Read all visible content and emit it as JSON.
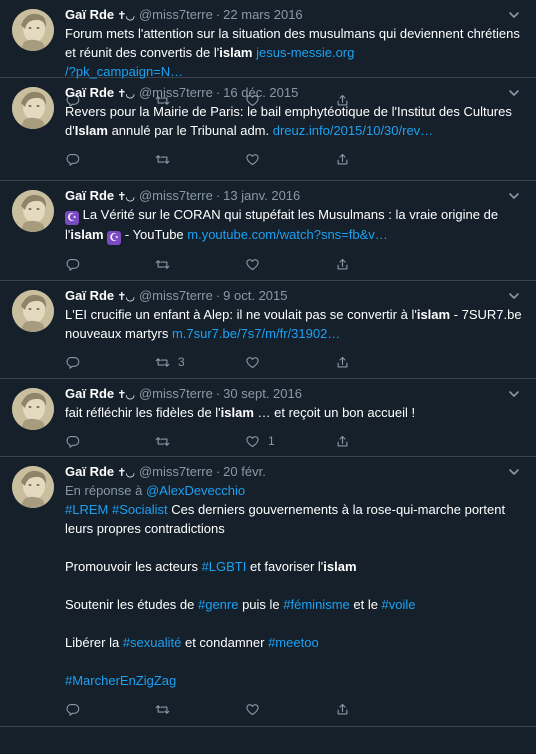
{
  "tweets": [
    {
      "name": "Gaï Rde",
      "badge": "✝◡",
      "handle": "@miss7terre",
      "sep": "·",
      "date": "22 mars 2016",
      "segments": [
        {
          "t": "Forum mets l'attention sur la situation des musulmans qui deviennent chrétiens et réunit des convertis de l'"
        },
        {
          "t": "islam",
          "b": true
        },
        {
          "t": " "
        },
        {
          "t": "jesus-messie.org\n/?pk_campaign=N…",
          "l": true
        }
      ],
      "counts": {
        "reply": "",
        "retweet": "",
        "like": ""
      }
    },
    {
      "name": "Gaï Rde",
      "badge": "✝◡",
      "handle": "@miss7terre",
      "sep": "·",
      "date": "16 déc. 2015",
      "segments": [
        {
          "t": "Revers pour la Mairie de Paris: le bail emphytéotique de l'Institut des Cultures d'"
        },
        {
          "t": "Islam",
          "b": true
        },
        {
          "t": " annulé par le Tribunal adm. "
        },
        {
          "t": "dreuz.info/2015/10/30/rev…",
          "l": true
        }
      ],
      "counts": {
        "reply": "",
        "retweet": "",
        "like": ""
      }
    },
    {
      "name": "Gaï Rde",
      "badge": "✝◡",
      "handle": "@miss7terre",
      "sep": "·",
      "date": "13 janv. 2016",
      "segments": [
        {
          "e": "☪"
        },
        {
          "t": " La Vérité sur le CORAN qui stupéfait les Musulmans : la vraie origine de l'"
        },
        {
          "t": "islam",
          "b": true
        },
        {
          "t": " "
        },
        {
          "e": "☪"
        },
        {
          "t": " - YouTube "
        },
        {
          "t": "m.youtube.com/watch?sns=fb&v…",
          "l": true
        }
      ],
      "counts": {
        "reply": "",
        "retweet": "",
        "like": ""
      }
    },
    {
      "name": "Gaï Rde",
      "badge": "✝◡",
      "handle": "@miss7terre",
      "sep": "·",
      "date": "9 oct. 2015",
      "segments": [
        {
          "t": "L'EI crucifie un enfant à Alep: il ne voulait pas se convertir à l'"
        },
        {
          "t": "islam",
          "b": true
        },
        {
          "t": " - 7SUR7.be nouveaux martyrs "
        },
        {
          "t": "m.7sur7.be/7s7/m/fr/31902…",
          "l": true
        }
      ],
      "counts": {
        "reply": "",
        "retweet": "3",
        "like": ""
      }
    },
    {
      "name": "Gaï Rde",
      "badge": "✝◡",
      "handle": "@miss7terre",
      "sep": "·",
      "date": "30 sept. 2016",
      "segments": [
        {
          "t": "fait réfléchir les fidèles de l'"
        },
        {
          "t": "islam",
          "b": true
        },
        {
          "t": " … et reçoit un bon accueil !"
        }
      ],
      "counts": {
        "reply": "",
        "retweet": "",
        "like": "1"
      }
    },
    {
      "name": "Gaï Rde",
      "badge": "✝◡",
      "handle": "@miss7terre",
      "sep": "·",
      "date": "20 févr.",
      "reply_prefix": "En réponse à ",
      "reply_to": "@AlexDevecchio",
      "segments": [
        {
          "t": "#LREM",
          "l": true
        },
        {
          "t": " "
        },
        {
          "t": "#Socialist",
          "l": true
        },
        {
          "t": " Ces derniers gouvernements à la rose-qui-marche portent leurs propres contradictions\n\nPromouvoir les acteurs "
        },
        {
          "t": "#LGBTI",
          "l": true
        },
        {
          "t": " et favoriser l'"
        },
        {
          "t": "islam",
          "b": true
        },
        {
          "t": "\n\nSoutenir les études de "
        },
        {
          "t": "#genre",
          "l": true
        },
        {
          "t": " puis le "
        },
        {
          "t": "#féminisme",
          "l": true
        },
        {
          "t": " et le "
        },
        {
          "t": "#voile",
          "l": true
        },
        {
          "t": "\n\nLibérer la "
        },
        {
          "t": "#sexualité",
          "l": true
        },
        {
          "t": " et condamner "
        },
        {
          "t": "#meetoo",
          "l": true
        },
        {
          "t": "\n\n"
        },
        {
          "t": "#MarcherEnZigZag",
          "l": true
        }
      ],
      "counts": {
        "reply": "",
        "retweet": "",
        "like": ""
      }
    }
  ],
  "icons": {
    "reply": "reply-icon",
    "retweet": "retweet-icon",
    "like": "like-icon",
    "share": "share-icon",
    "more": "chevron-down-icon"
  },
  "colors": {
    "background": "#15202b",
    "divider": "#38444d",
    "muted": "#8899a6",
    "link": "#1da1f2"
  }
}
